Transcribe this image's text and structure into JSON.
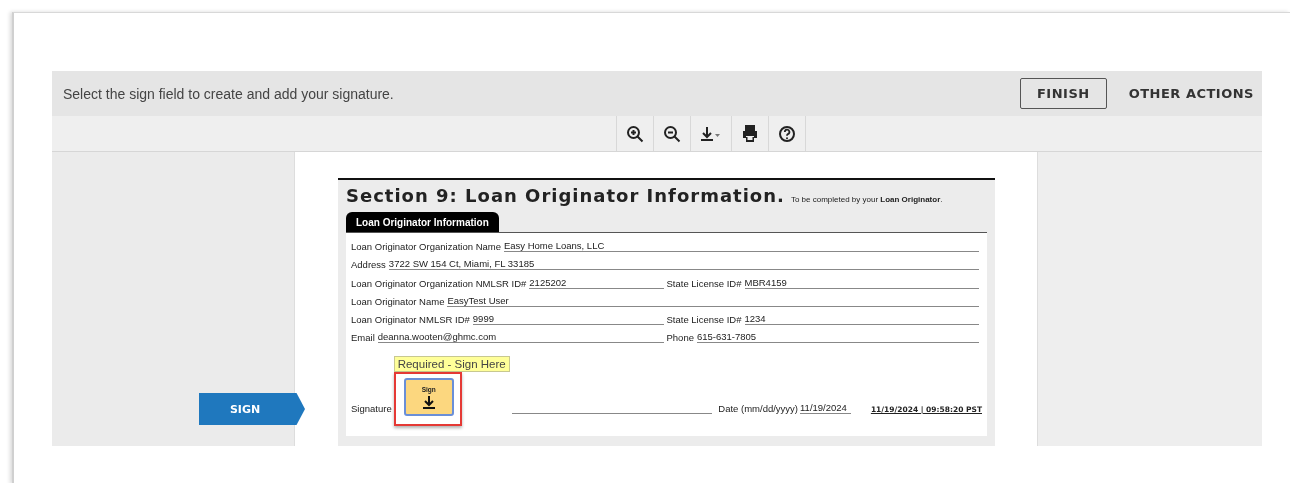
{
  "toolbar": {
    "message": "Select the sign field to create and add your signature.",
    "buttons": [
      {
        "label": "FINISH",
        "kind": "outlined"
      },
      {
        "label": "OTHER ACTIONS",
        "kind": "text"
      }
    ]
  },
  "sign_tag": {
    "label": "SIGN"
  },
  "document": {
    "section_title": "Section 9: Loan Originator Information.",
    "section_note": "To be completed by your **Loan Originator**.",
    "tab": "Loan Originator Information",
    "rows": [
      {
        "fields": [
          {
            "label": "Loan Originator Organization Name",
            "value": "Easy Home Loans, LLC"
          }
        ]
      },
      {
        "fields": [
          {
            "label": "Address",
            "value": "3722 SW 154 Ct, Miami, FL 33185"
          }
        ]
      },
      {
        "fields": [
          {
            "label": "Loan Originator Organization NMLSR ID#",
            "value": "2125202"
          },
          {
            "label": "State License ID#",
            "value": "MBR4159"
          }
        ]
      },
      {
        "fields": [
          {
            "label": "Loan Originator Name",
            "value": "EasyTest User"
          }
        ]
      },
      {
        "fields": [
          {
            "label": "Loan Originator NMLSR ID#",
            "value": "9999"
          },
          {
            "label": "State License ID#",
            "value": "1234"
          }
        ]
      },
      {
        "fields": [
          {
            "label": "Email",
            "value": "deanna.wooten@ghmc.com"
          },
          {
            "label": "Phone",
            "value": "615-631-7805"
          }
        ]
      }
    ],
    "signature": {
      "label": "Signature",
      "tooltip": "Required - Sign Here",
      "button": "Sign",
      "date_label": "Date (mm/dd/yyyy)",
      "date_value": "11/19/2024",
      "timestamp": "11/19/2024 | 09:58:20 PST"
    }
  }
}
